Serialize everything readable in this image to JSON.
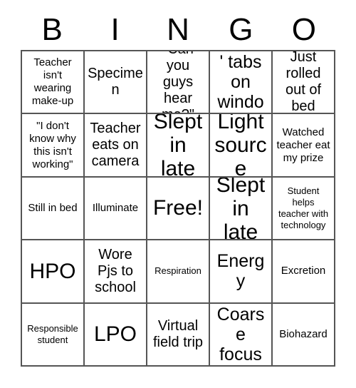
{
  "card": {
    "title_letters": [
      "B",
      "I",
      "N",
      "G",
      "O"
    ],
    "columns": 5,
    "rows": 5,
    "free_space_label": "Free!",
    "free_space_position": {
      "row": 3,
      "column": 3
    },
    "border_color": "#555555",
    "text_color": "#000000",
    "background_color": "#ffffff",
    "cells": [
      [
        {
          "text": "Teacher isn't wearing make-up",
          "size": "sm"
        },
        {
          "text": "Specimen",
          "size": "md"
        },
        {
          "text": "\"Can you guys hear me?\"",
          "size": "md"
        },
        {
          "text": "'Wrong' tabs on window",
          "size": "lg"
        },
        {
          "text": "Just rolled out of bed",
          "size": "md"
        }
      ],
      [
        {
          "text": "\"I don't know why this isn't working\"",
          "size": "sm"
        },
        {
          "text": "Teacher eats on camera",
          "size": "md"
        },
        {
          "text": "Slept in late",
          "size": "xl"
        },
        {
          "text": "Light source",
          "size": "xl"
        },
        {
          "text": "Watched teacher eat my prize",
          "size": "sm"
        }
      ],
      [
        {
          "text": "Still in bed",
          "size": "sm"
        },
        {
          "text": "Illuminate",
          "size": "sm"
        },
        {
          "text": "Free!",
          "size": "xl"
        },
        {
          "text": "Slept in late",
          "size": "xl"
        },
        {
          "text": "Student helps teacher with technology",
          "size": "xs"
        }
      ],
      [
        {
          "text": "HPO",
          "size": "xl"
        },
        {
          "text": "Wore Pjs to school",
          "size": "md"
        },
        {
          "text": "Respiration",
          "size": "xs"
        },
        {
          "text": "Energy",
          "size": "lg"
        },
        {
          "text": "Excretion",
          "size": "sm"
        }
      ],
      [
        {
          "text": "Responsible student",
          "size": "xs"
        },
        {
          "text": "LPO",
          "size": "xl"
        },
        {
          "text": "Virtual field trip",
          "size": "md"
        },
        {
          "text": "Coarse focus",
          "size": "lg"
        },
        {
          "text": "Biohazard",
          "size": "sm"
        }
      ]
    ]
  }
}
